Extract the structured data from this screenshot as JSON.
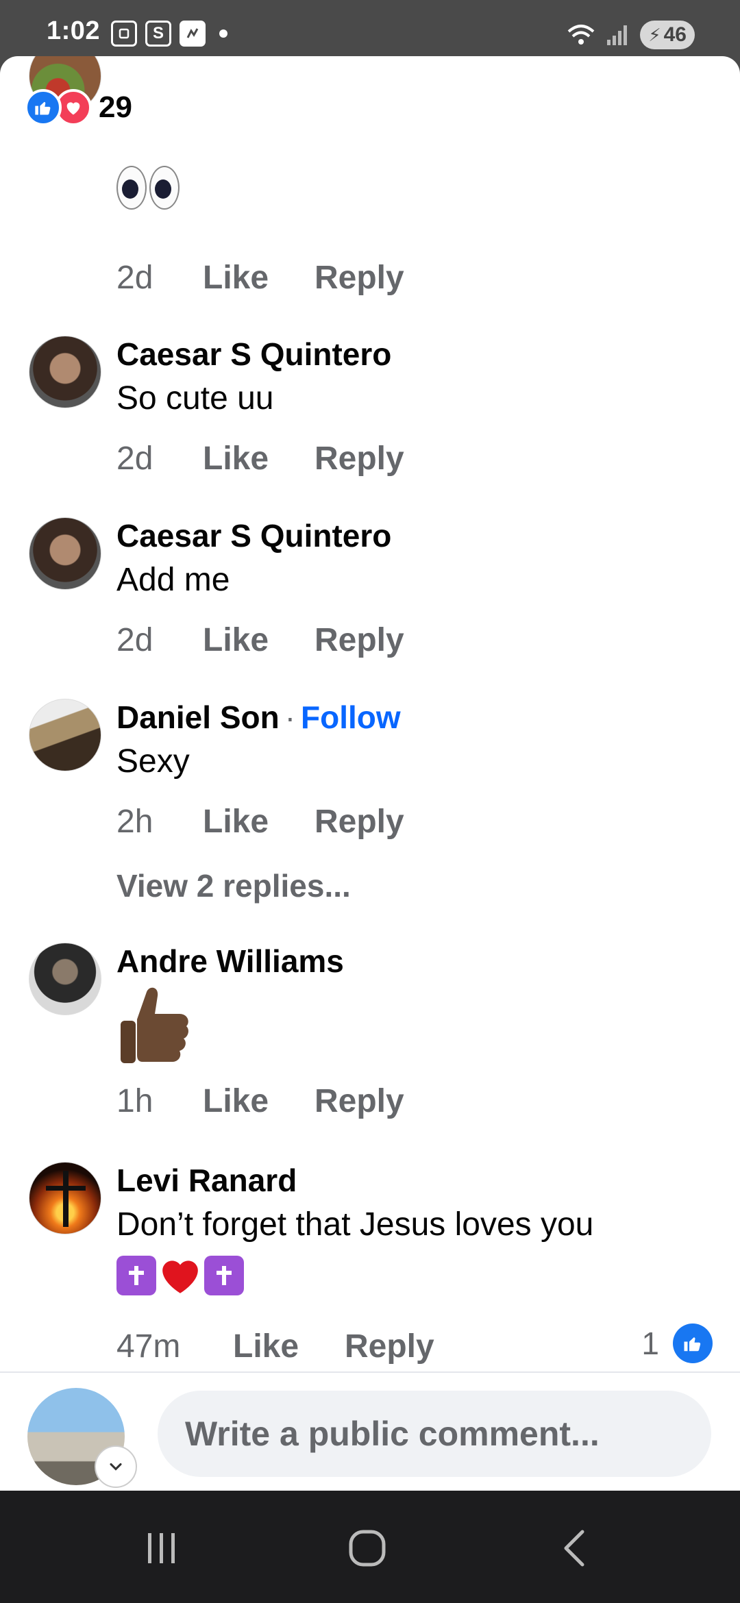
{
  "status_bar": {
    "time": "1:02",
    "icon_s": "S",
    "battery": "46",
    "signal_label": "6"
  },
  "reactions": {
    "count": "29"
  },
  "comments": [
    {
      "text": "👀",
      "time": "2d",
      "like": "Like",
      "reply": "Reply"
    },
    {
      "name": "Caesar S Quintero",
      "text": "So cute uu",
      "time": "2d",
      "like": "Like",
      "reply": "Reply"
    },
    {
      "name": "Caesar S Quintero",
      "text": "Add me",
      "time": "2d",
      "like": "Like",
      "reply": "Reply"
    },
    {
      "name": "Daniel Son",
      "follow": "Follow",
      "separator": "·",
      "text": "Sexy",
      "time": "2h",
      "like": "Like",
      "reply": "Reply",
      "view_replies": "View 2 replies..."
    },
    {
      "name": "Andre Williams",
      "text": "👍🏿",
      "time": "1h",
      "like": "Like",
      "reply": "Reply"
    },
    {
      "name": "Levi Ranard",
      "text": "Don’t forget that Jesus loves you",
      "time": "47m",
      "like": "Like",
      "reply": "Reply",
      "like_count": "1"
    }
  ],
  "composer": {
    "placeholder": "Write a public comment..."
  },
  "colors": {
    "accent": "#1877f2",
    "follow": "#0866ff",
    "meta": "#65676b",
    "love": "#f33e58"
  },
  "icons": [
    "like-reaction-icon",
    "love-reaction-icon",
    "chevron-down-icon",
    "recents-icon",
    "home-icon",
    "back-icon"
  ]
}
